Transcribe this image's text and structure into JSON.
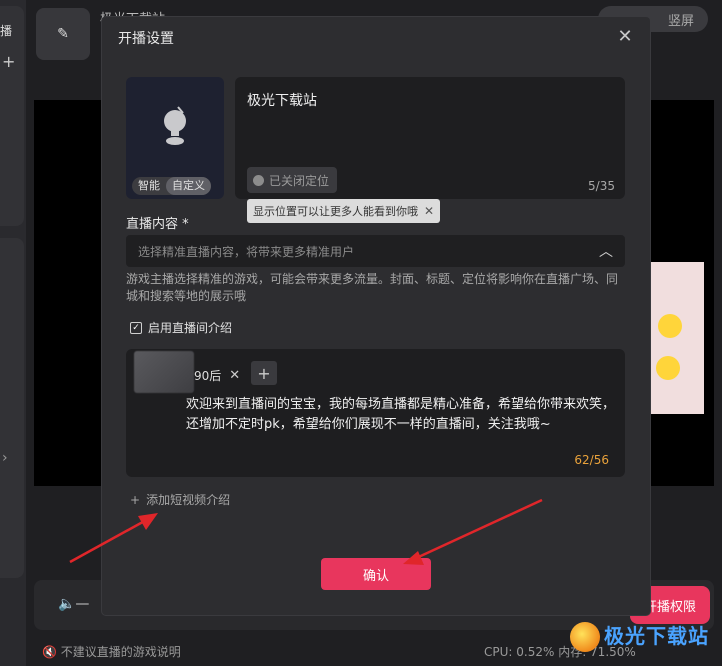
{
  "background": {
    "left_tab_label": "播",
    "header_title": "极光下载站",
    "top_right_label": "竖屏",
    "bottom_right_button": "开播权限",
    "status_text": "不建议直播的游戏说明",
    "cpu_text": "CPU: 0.52%  内存: 71.50%",
    "watermark_text": "极光下载站"
  },
  "dialog": {
    "title": "开播设置",
    "cover": {
      "tabs": [
        "智能",
        "自定义"
      ],
      "active_tab": "自定义"
    },
    "title_field": {
      "value": "极光下载站",
      "location_chip": "已关闭定位",
      "count": "5/35"
    },
    "location_tooltip": "显示位置可以让更多人能看到你哦",
    "content": {
      "label": "直播内容 *",
      "placeholder": "选择精准直播内容，将带来更多精准用户",
      "hint": "游戏主播选择精准的游戏，可能会带来更多流量。封面、标题、定位将影响你在直播广场、同城和搜索等地的展示哦"
    },
    "intro": {
      "checkbox_label": "启用直播间介绍",
      "checked": true,
      "tag": "90后",
      "text": "欢迎来到直播间的宝宝，我的每场直播都是精心准备，希望给你带来欢笑，还增加不定时pk，希望给你们展现不一样的直播间，关注我哦~",
      "count": "62/56"
    },
    "add_video_label": "添加短视频介绍",
    "confirm_label": "确认"
  },
  "colors": {
    "accent": "#e8365d",
    "count_warning": "#e9a23b",
    "annotation_arrow": "#e0262a"
  }
}
